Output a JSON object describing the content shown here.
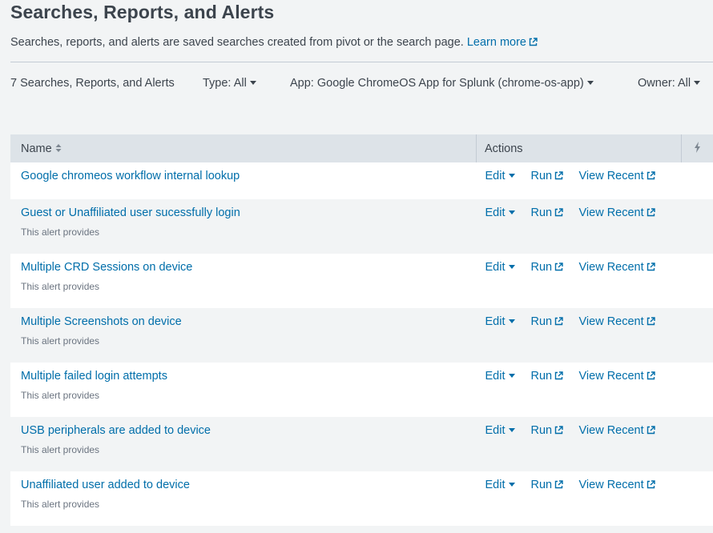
{
  "page": {
    "title": "Searches, Reports, and Alerts",
    "description": "Searches, reports, and alerts are saved searches created from pivot or the search page.",
    "learn_more": "Learn more"
  },
  "filters": {
    "count_label": "7 Searches, Reports, and Alerts",
    "type": "Type: All",
    "app": "App: Google ChromeOS App for Splunk (chrome-os-app)",
    "owner": "Owner: All"
  },
  "table": {
    "headers": {
      "name": "Name",
      "actions": "Actions"
    },
    "actions": {
      "edit": "Edit",
      "run": "Run",
      "view_recent": "View Recent"
    },
    "rows": [
      {
        "name": "Google chromeos workflow internal lookup",
        "description": ""
      },
      {
        "name": "Guest or Unaffiliated user sucessfully login",
        "description": "This alert provides"
      },
      {
        "name": "Multiple CRD Sessions on device",
        "description": "This alert provides"
      },
      {
        "name": "Multiple Screenshots on device",
        "description": "This alert provides"
      },
      {
        "name": "Multiple failed login attempts",
        "description": "This alert provides"
      },
      {
        "name": "USB peripherals are added to device",
        "description": "This alert provides"
      },
      {
        "name": "Unaffiliated user added to device",
        "description": "This alert provides"
      }
    ]
  },
  "icons": {
    "external_link": "external-link-icon",
    "sort": "sort-icon",
    "bolt": "lightning-bolt-icon",
    "caret": "caret-down-icon"
  },
  "colors": {
    "link": "#006eaa",
    "text": "#3c444d",
    "header_bg": "#dde3e8",
    "page_bg": "#f2f4f5"
  }
}
